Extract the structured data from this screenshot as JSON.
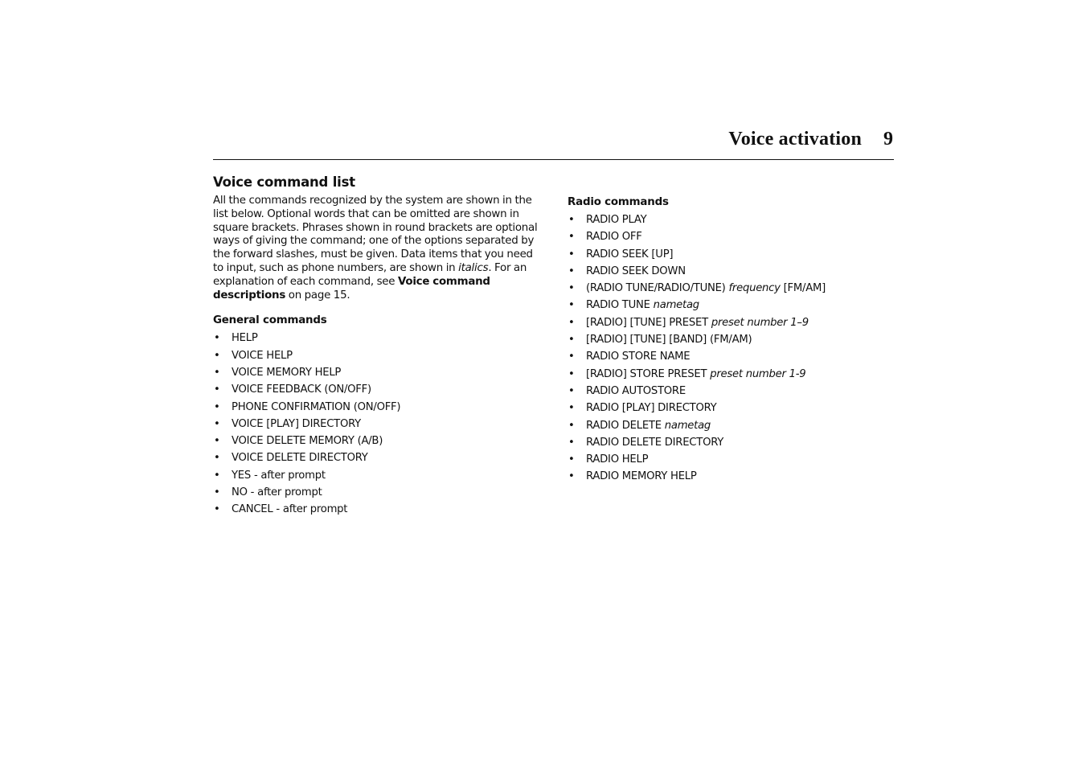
{
  "header": {
    "title": "Voice activation",
    "page_number": "9"
  },
  "left": {
    "section_title": "Voice command list",
    "intro": {
      "part1": "All the commands recognized by the system are shown in the list below. Optional words that can be omitted are shown in square brackets. Phrases shown in round brackets are optional ways of giving the command; one of the options separated by the forward slashes, must be given. Data items that you need to input, such as phone numbers, are shown in ",
      "italic_word": "italics",
      "part2": ". For an explanation of each command, see ",
      "bold_link": "Voice command descriptions",
      "part3": " on page 15."
    },
    "general_title": "General commands",
    "general_commands": [
      {
        "text": "HELP",
        "italic": ""
      },
      {
        "text": "VOICE HELP",
        "italic": ""
      },
      {
        "text": "VOICE MEMORY HELP",
        "italic": ""
      },
      {
        "text": "VOICE FEEDBACK (ON/OFF)",
        "italic": ""
      },
      {
        "text": "PHONE CONFIRMATION (ON/OFF)",
        "italic": ""
      },
      {
        "text": "VOICE [PLAY] DIRECTORY",
        "italic": ""
      },
      {
        "text": "VOICE DELETE MEMORY (A/B)",
        "italic": ""
      },
      {
        "text": "VOICE DELETE DIRECTORY",
        "italic": ""
      },
      {
        "text": "YES - after prompt",
        "italic": ""
      },
      {
        "text": "NO - after prompt",
        "italic": ""
      },
      {
        "text": "CANCEL - after prompt",
        "italic": ""
      }
    ]
  },
  "right": {
    "radio_title": "Radio commands",
    "radio_commands": [
      {
        "text": "RADIO PLAY",
        "italic": "",
        "after": ""
      },
      {
        "text": "RADIO OFF",
        "italic": "",
        "after": ""
      },
      {
        "text": "RADIO SEEK [UP]",
        "italic": "",
        "after": ""
      },
      {
        "text": "RADIO SEEK DOWN",
        "italic": "",
        "after": ""
      },
      {
        "text": "(RADIO TUNE/RADIO/TUNE) ",
        "italic": "frequency",
        "after": " [FM/AM]"
      },
      {
        "text": "RADIO TUNE ",
        "italic": "nametag",
        "after": ""
      },
      {
        "text": "[RADIO] [TUNE] PRESET ",
        "italic": "preset number 1–9",
        "after": ""
      },
      {
        "text": "[RADIO] [TUNE] [BAND] (FM/AM)",
        "italic": "",
        "after": ""
      },
      {
        "text": "RADIO STORE NAME",
        "italic": "",
        "after": ""
      },
      {
        "text": "[RADIO] STORE PRESET ",
        "italic": "preset number 1-9",
        "after": ""
      },
      {
        "text": "RADIO AUTOSTORE",
        "italic": "",
        "after": ""
      },
      {
        "text": "RADIO [PLAY] DIRECTORY",
        "italic": "",
        "after": ""
      },
      {
        "text": "RADIO DELETE ",
        "italic": "nametag",
        "after": ""
      },
      {
        "text": "RADIO DELETE DIRECTORY",
        "italic": "",
        "after": ""
      },
      {
        "text": "RADIO HELP",
        "italic": "",
        "after": ""
      },
      {
        "text": "RADIO MEMORY HELP",
        "italic": "",
        "after": ""
      }
    ]
  },
  "bullet_glyph": "•"
}
